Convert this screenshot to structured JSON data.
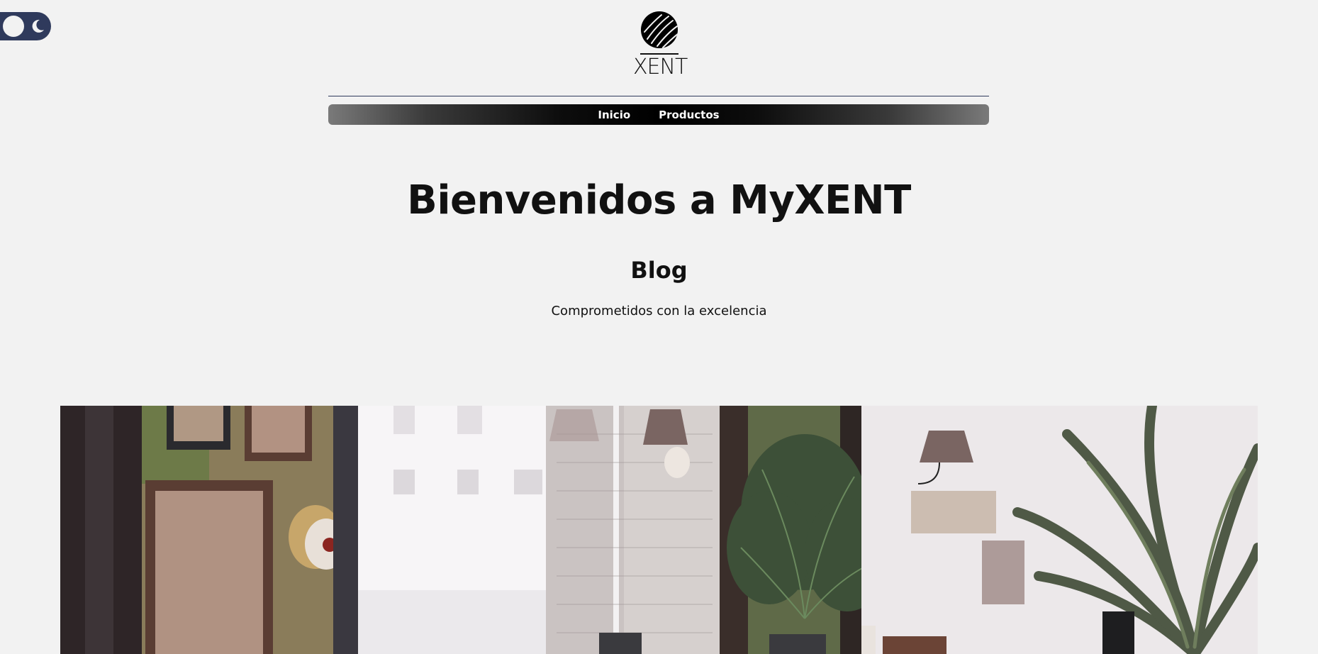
{
  "theme_toggle": {
    "icon_sun": "circle-icon",
    "icon_moon": "moon-icon",
    "color": "#2f3a5c"
  },
  "header": {
    "logo": {
      "text": "XENT",
      "icon": "striped-ball-icon"
    },
    "nav": {
      "items": [
        {
          "label": "Inicio"
        },
        {
          "label": "Productos"
        }
      ]
    }
  },
  "main": {
    "title": "Bienvenidos a MyXENT",
    "section_title": "Blog",
    "tagline": "Comprometidos con la excelencia"
  },
  "hero_image": {
    "icon": "cafe-interior-photo"
  },
  "colors": {
    "background": "#f2f2f2",
    "accent": "#2f3a5c",
    "text": "#111111"
  }
}
